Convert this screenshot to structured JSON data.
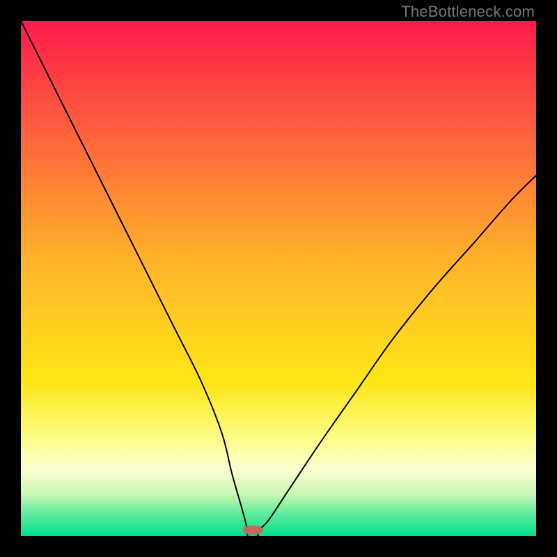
{
  "watermark": "TheBottleneck.com",
  "chart_data": {
    "type": "line",
    "title": "",
    "xlabel": "",
    "ylabel": "",
    "xlim": [
      0,
      100
    ],
    "ylim": [
      0,
      100
    ],
    "grid": false,
    "legend": false,
    "gradient_stops": [
      {
        "offset": 0.0,
        "color": "#ff1a4c"
      },
      {
        "offset": 0.46,
        "color": "#ffb22b"
      },
      {
        "offset": 0.7,
        "color": "#ffe616"
      },
      {
        "offset": 0.81,
        "color": "#fdfd87"
      },
      {
        "offset": 0.87,
        "color": "#fbfed0"
      },
      {
        "offset": 0.92,
        "color": "#c7f7b2"
      },
      {
        "offset": 0.95,
        "color": "#6eeda1"
      },
      {
        "offset": 1.0,
        "color": "#00e08a"
      }
    ],
    "series": [
      {
        "name": "bottleneck-curve",
        "x": [
          0,
          5,
          10,
          15,
          20,
          25,
          30,
          35,
          39,
          41,
          43,
          44,
          44,
          46,
          46,
          48,
          52,
          58,
          65,
          72,
          80,
          88,
          95,
          100
        ],
        "values": [
          100,
          90,
          80,
          70,
          60,
          50,
          40,
          30,
          20,
          12,
          5,
          1,
          0,
          0,
          1,
          3,
          9,
          18,
          28,
          38,
          48,
          57,
          65,
          70
        ]
      }
    ],
    "marker": {
      "name": "optimal-point",
      "x": 45,
      "y": 1.2,
      "rx": 2.0,
      "ry": 0.9,
      "color": "#c46a5d"
    }
  }
}
